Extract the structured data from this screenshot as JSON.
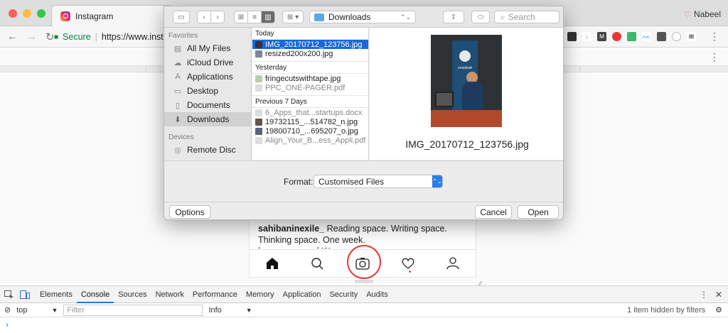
{
  "browser": {
    "tab_title": "Instagram",
    "profile_name": "Nabeel",
    "omnibox": {
      "secure_label": "Secure",
      "url": "https://www.insta"
    }
  },
  "instagram": {
    "post_user": "sahibaninexile_",
    "post_text": "Reading space. Writing space. Thinking space. One week.",
    "post_cut": "hopes_poured Wow"
  },
  "devtools": {
    "tabs": [
      "Elements",
      "Console",
      "Sources",
      "Network",
      "Performance",
      "Memory",
      "Application",
      "Security",
      "Audits"
    ],
    "active_tab": "Console",
    "context": "top",
    "filter_placeholder": "Filter",
    "level": "Info",
    "hidden_note": "1 item hidden by filters",
    "prompt": "›"
  },
  "dialog": {
    "location": "Downloads",
    "search_placeholder": "Search",
    "sidebar": {
      "favorites_header": "Favorites",
      "favorites": [
        "All My Files",
        "iCloud Drive",
        "Applications",
        "Desktop",
        "Documents",
        "Downloads"
      ],
      "devices_header": "Devices",
      "devices": [
        "Remote Disc"
      ],
      "selected": "Downloads"
    },
    "groups": {
      "today": {
        "label": "Today",
        "files": [
          "IMG_20170712_123756.jpg",
          "resized200x200.jpg"
        ]
      },
      "yesterday": {
        "label": "Yesterday",
        "files": [
          "fringecutswithtape.jpg",
          "PPC_ONE-PAGER.pdf"
        ]
      },
      "previous": {
        "label": "Previous 7 Days",
        "files": [
          "6_Apps_that...startups.docx",
          "19732115_...514782_n.jpg",
          "19800710_...695207_o.jpg",
          "Align_Your_B...ess_Appli.pdf"
        ]
      }
    },
    "selected_file": "IMG_20170712_123756.jpg",
    "preview_banner_text": "crozdesk",
    "format_label": "Format:",
    "format_value": "Customised Files",
    "options_label": "Options",
    "cancel_label": "Cancel",
    "open_label": "Open"
  }
}
